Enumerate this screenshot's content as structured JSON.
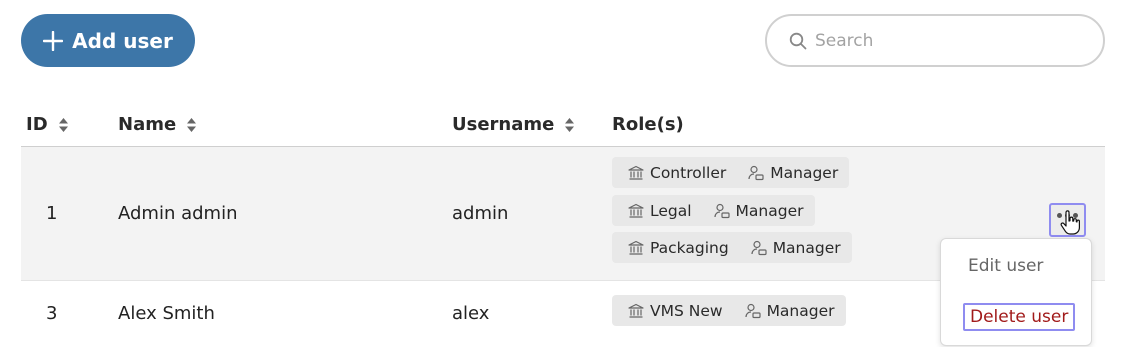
{
  "toolbar": {
    "add_user_label": "Add user",
    "search_placeholder": "Search"
  },
  "table": {
    "columns": [
      "ID",
      "Name",
      "Username",
      "Role(s)"
    ],
    "rows": [
      {
        "id": "1",
        "name": "Admin admin",
        "username": "admin",
        "roles": [
          {
            "org": "Controller",
            "role": "Manager"
          },
          {
            "org": "Legal",
            "role": "Manager"
          },
          {
            "org": "Packaging",
            "role": "Manager"
          }
        ]
      },
      {
        "id": "3",
        "name": "Alex Smith",
        "username": "alex",
        "roles": [
          {
            "org": "VMS New",
            "role": "Manager"
          }
        ]
      }
    ]
  },
  "row_menu": {
    "edit_label": "Edit user",
    "delete_label": "Delete user"
  },
  "colors": {
    "accent": "#3d76a8",
    "delete": "#a11a1a",
    "focus_outline": "#8f8cf0",
    "row_highlight": "#f3f3f3",
    "chip_background": "#e8e8e8"
  },
  "icons": {
    "add": "plus-icon",
    "search": "search-icon",
    "sort": "sort-icon",
    "organization": "building-icon",
    "role": "user-role-icon",
    "more": "more-icon"
  }
}
